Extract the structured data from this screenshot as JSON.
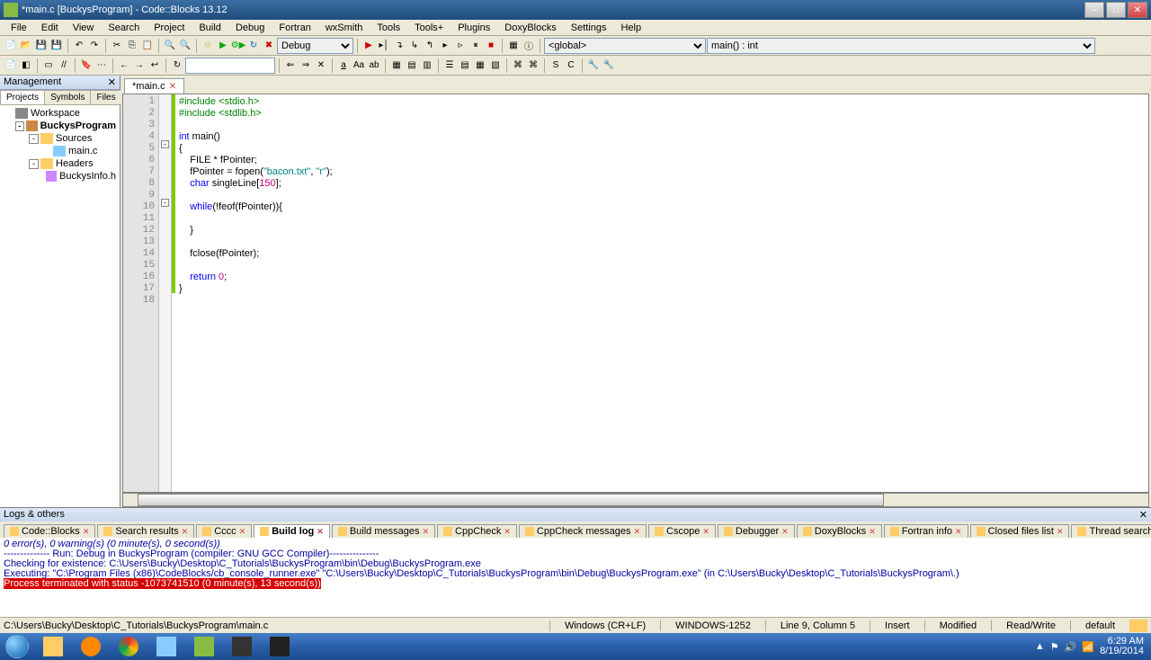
{
  "window": {
    "title": "*main.c [BuckysProgram] - Code::Blocks 13.12",
    "min": "–",
    "max": "□",
    "close": "✕"
  },
  "menu": [
    "File",
    "Edit",
    "View",
    "Search",
    "Project",
    "Build",
    "Debug",
    "Fortran",
    "wxSmith",
    "Tools",
    "Tools+",
    "Plugins",
    "DoxyBlocks",
    "Settings",
    "Help"
  ],
  "toolbar": {
    "target": "Debug",
    "scope": "<global>",
    "func": "main() : int"
  },
  "sidebar": {
    "title": "Management",
    "tabs": [
      "Projects",
      "Symbols",
      "Files"
    ],
    "tree": [
      {
        "indent": 0,
        "exp": "",
        "icon": "workspace",
        "label": "Workspace",
        "bold": false
      },
      {
        "indent": 1,
        "exp": "-",
        "icon": "project",
        "label": "BuckysProgram",
        "bold": true
      },
      {
        "indent": 2,
        "exp": "-",
        "icon": "folder",
        "label": "Sources",
        "bold": false
      },
      {
        "indent": 3,
        "exp": "",
        "icon": "cfile",
        "label": "main.c",
        "bold": false
      },
      {
        "indent": 2,
        "exp": "-",
        "icon": "folder",
        "label": "Headers",
        "bold": false
      },
      {
        "indent": 3,
        "exp": "",
        "icon": "hfile",
        "label": "BuckysInfo.h",
        "bold": false
      }
    ]
  },
  "editor": {
    "tab": "*main.c",
    "lines": [
      {
        "n": 1,
        "html": "<span class='pp'>#include &lt;stdio.h&gt;</span>",
        "chg": true
      },
      {
        "n": 2,
        "html": "<span class='pp'>#include &lt;stdlib.h&gt;</span>",
        "chg": true
      },
      {
        "n": 3,
        "html": "",
        "chg": true
      },
      {
        "n": 4,
        "html": "<span class='kw'>int</span> main()",
        "chg": true
      },
      {
        "n": 5,
        "html": "{",
        "chg": true,
        "fold": 51
      },
      {
        "n": 6,
        "html": "    FILE * fPointer;",
        "chg": true
      },
      {
        "n": 7,
        "html": "    fPointer = fopen(<span class='str'>\"bacon.txt\"</span>, <span class='str'>\"r\"</span>);",
        "chg": true
      },
      {
        "n": 8,
        "html": "    <span class='kw'>char</span> singleLine[<span class='num'>150</span>];",
        "chg": true
      },
      {
        "n": 9,
        "html": "    ",
        "chg": true
      },
      {
        "n": 10,
        "html": "    <span class='kw'>while</span>(!feof(fPointer)){",
        "chg": true,
        "fold": 116
      },
      {
        "n": 11,
        "html": "",
        "chg": true
      },
      {
        "n": 12,
        "html": "    }",
        "chg": true
      },
      {
        "n": 13,
        "html": "",
        "chg": true
      },
      {
        "n": 14,
        "html": "    fclose(fPointer);",
        "chg": true
      },
      {
        "n": 15,
        "html": "",
        "chg": true
      },
      {
        "n": 16,
        "html": "    <span class='kw'>return</span> <span class='num'>0</span>;",
        "chg": true
      },
      {
        "n": 17,
        "html": "}",
        "chg": true
      },
      {
        "n": 18,
        "html": "",
        "chg": false
      }
    ]
  },
  "logs": {
    "title": "Logs & others",
    "tabs": [
      "Code::Blocks",
      "Search results",
      "Cccc",
      "Build log",
      "Build messages",
      "CppCheck",
      "CppCheck messages",
      "Cscope",
      "Debugger",
      "DoxyBlocks",
      "Fortran info",
      "Closed files list",
      "Thread search"
    ],
    "active": 3,
    "lines": [
      {
        "t": "0 error(s), 0 warning(s) (0 minute(s), 0 second(s))",
        "it": true
      },
      {
        "t": " "
      },
      {
        "t": "-------------- Run: Debug in BuckysProgram (compiler: GNU GCC Compiler)---------------"
      },
      {
        "t": "Checking for existence: C:\\Users\\Bucky\\Desktop\\C_Tutorials\\BuckysProgram\\bin\\Debug\\BuckysProgram.exe"
      },
      {
        "t": "Executing: \"C:\\Program Files (x86)\\CodeBlocks/cb_console_runner.exe\" \"C:\\Users\\Bucky\\Desktop\\C_Tutorials\\BuckysProgram\\bin\\Debug\\BuckysProgram.exe\"  (in C:\\Users\\Bucky\\Desktop\\C_Tutorials\\BuckysProgram\\.)"
      },
      {
        "t": "Process terminated with status -1073741510 (0 minute(s), 13 second(s))",
        "err": true
      }
    ]
  },
  "status": {
    "path": "C:\\Users\\Bucky\\Desktop\\C_Tutorials\\BuckysProgram\\main.c",
    "eol": "Windows (CR+LF)",
    "enc": "WINDOWS-1252",
    "pos": "Line 9, Column 5",
    "ins": "Insert",
    "mod": "Modified",
    "rw": "Read/Write",
    "prof": "default"
  },
  "tray": {
    "time": "6:29 AM",
    "date": "8/19/2014"
  }
}
